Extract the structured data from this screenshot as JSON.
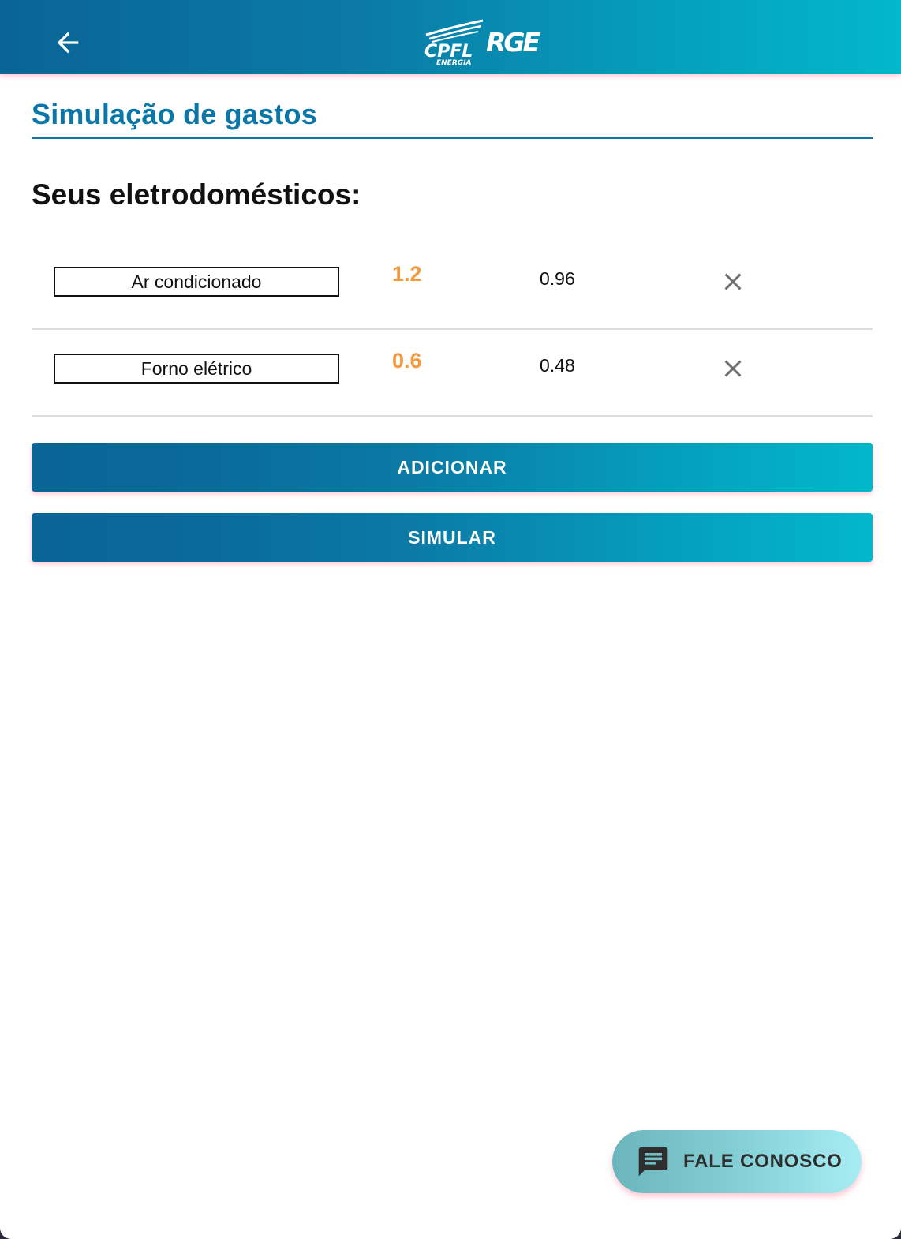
{
  "header": {
    "back_icon": "arrow-left-icon",
    "logo_text": "CPFL ENERGIA RGE",
    "colors": {
      "gradient_start": "#0a6496",
      "gradient_end": "#03b7cc"
    }
  },
  "page": {
    "title": "Simulação de gastos",
    "section_title": "Seus eletrodomésticos:"
  },
  "appliances": [
    {
      "name": "Ar condicionado",
      "hours": "1.2",
      "kwh": "0.96",
      "remove_icon": "close-icon"
    },
    {
      "name": "Forno elétrico",
      "hours": "0.6",
      "kwh": "0.48",
      "remove_icon": "close-icon"
    }
  ],
  "actions": {
    "add_label": "ADICIONAR",
    "simulate_label": "SIMULAR"
  },
  "fab": {
    "label": "FALE CONOSCO",
    "icon": "chat-message-icon"
  },
  "colors": {
    "accent_blue": "#0b77a8",
    "hours_orange": "#f39a3d"
  }
}
